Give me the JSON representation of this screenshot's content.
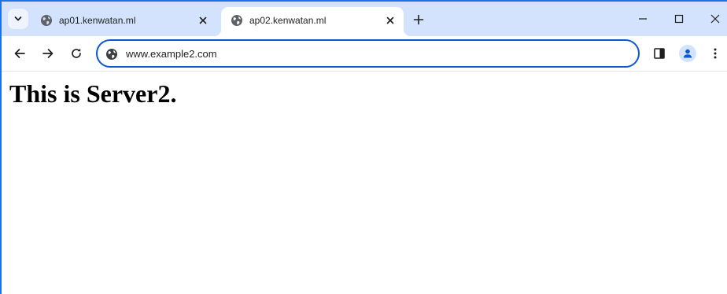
{
  "browser": {
    "tabs": [
      {
        "title": "ap01.kenwatan.ml",
        "active": false,
        "favicon": "globe-icon"
      },
      {
        "title": "ap02.kenwatan.ml",
        "active": true,
        "favicon": "globe-icon"
      }
    ],
    "new_tab_icon": "plus-icon",
    "tab_search_icon": "chevron-down-icon",
    "window_controls": [
      "minimize-icon",
      "maximize-icon",
      "close-icon"
    ]
  },
  "toolbar": {
    "nav_icons": [
      "arrow-left-icon",
      "arrow-right-icon",
      "reload-icon"
    ],
    "address": {
      "value": "www.example2.com",
      "site_icon": "globe-icon"
    },
    "right_icons": [
      "side-panel-icon",
      "profile-icon",
      "more-vert-icon"
    ]
  },
  "page": {
    "heading": "This is Server2."
  },
  "colors": {
    "tabstrip_bg": "#d3e3fd",
    "omnibox_border": "#0b57d0",
    "frame_accent": "#1a73e8"
  }
}
